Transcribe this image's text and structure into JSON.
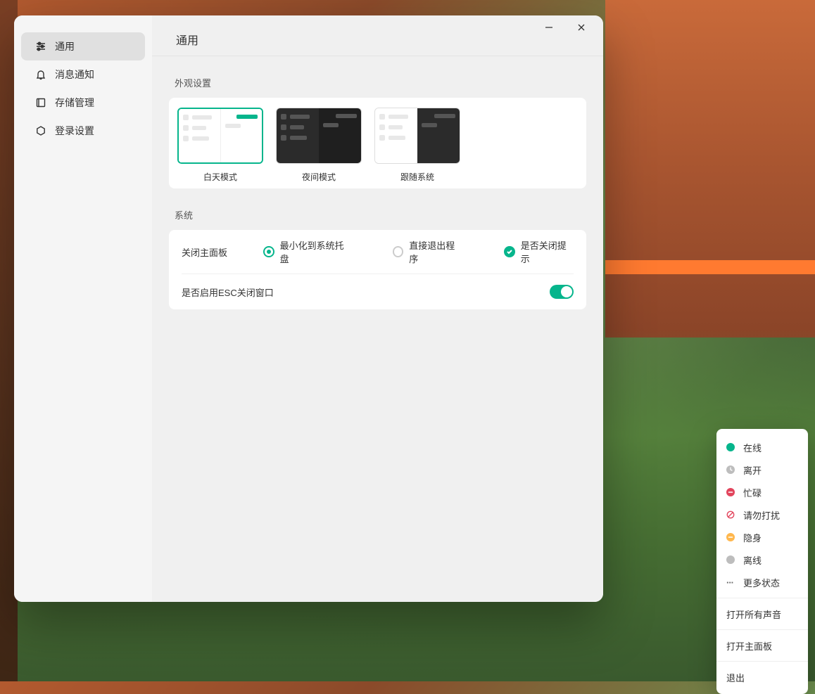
{
  "sidebar": {
    "items": [
      {
        "label": "通用",
        "icon": "sliders"
      },
      {
        "label": "消息通知",
        "icon": "bell"
      },
      {
        "label": "存储管理",
        "icon": "storage"
      },
      {
        "label": "登录设置",
        "icon": "hexagon"
      }
    ],
    "active_index": 0
  },
  "header": {
    "title": "通用"
  },
  "appearance": {
    "section_title": "外观设置",
    "options": [
      {
        "label": "白天模式",
        "selected": true
      },
      {
        "label": "夜间模式",
        "selected": false
      },
      {
        "label": "跟随系统",
        "selected": false
      }
    ]
  },
  "system": {
    "section_title": "系统",
    "close_panel": {
      "label": "关闭主面板",
      "option_minimize": "最小化到系统托盘",
      "option_exit": "直接退出程序",
      "selected": "minimize",
      "confirm_label": "是否关闭提示",
      "confirm_checked": true
    },
    "esc_close": {
      "label": "是否启用ESC关闭窗口",
      "enabled": true
    }
  },
  "status_menu": {
    "statuses": [
      {
        "label": "在线",
        "kind": "online"
      },
      {
        "label": "离开",
        "kind": "away"
      },
      {
        "label": "忙碌",
        "kind": "busy"
      },
      {
        "label": "请勿打扰",
        "kind": "dnd"
      },
      {
        "label": "隐身",
        "kind": "invisible"
      },
      {
        "label": "离线",
        "kind": "offline"
      }
    ],
    "more_status": "更多状态",
    "actions": [
      "打开所有声音",
      "打开主面板",
      "退出"
    ]
  },
  "colors": {
    "accent": "#06b58c",
    "danger": "#e2445c",
    "warn": "#ffb74d",
    "muted": "#bdbdbd"
  }
}
